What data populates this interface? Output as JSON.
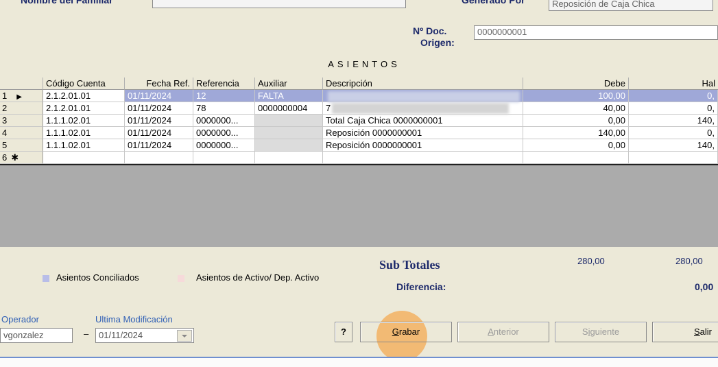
{
  "header": {
    "nombre_label": "Nombre del Familiar",
    "generado_label": "Generado Por",
    "generado_value": "Reposición de Caja Chica",
    "doc_label_1": "Nº Doc.",
    "doc_label_2": "Origen:",
    "doc_value": "0000000001"
  },
  "grid": {
    "title": "ASIENTOS",
    "columns": [
      "Código Cuenta",
      "Fecha Ref.",
      "Referencia",
      "Auxiliar",
      "Descripción",
      "Debe",
      "Hal"
    ],
    "rows": [
      {
        "num": "1",
        "marker": "▶",
        "codigo": "2.1.2.01.01",
        "fecha": "01/11/2024",
        "referencia": "12",
        "auxiliar": "FALTA",
        "descripcion": "",
        "debe": "100,00",
        "haber": "0,"
      },
      {
        "num": "2",
        "marker": "",
        "codigo": "2.1.2.01.01",
        "fecha": "01/11/2024",
        "referencia": "78",
        "auxiliar": "0000000004",
        "descripcion": "7",
        "debe": "40,00",
        "haber": "0,"
      },
      {
        "num": "3",
        "marker": "",
        "codigo": "1.1.1.02.01",
        "fecha": "01/11/2024",
        "referencia": "0000000...",
        "auxiliar": "",
        "descripcion": "Total Caja Chica 0000000001",
        "debe": "0,00",
        "haber": "140,"
      },
      {
        "num": "4",
        "marker": "",
        "codigo": "1.1.1.02.01",
        "fecha": "01/11/2024",
        "referencia": "0000000...",
        "auxiliar": "",
        "descripcion": "Reposición 0000000001",
        "debe": "140,00",
        "haber": "0,"
      },
      {
        "num": "5",
        "marker": "",
        "codigo": "1.1.1.02.01",
        "fecha": "01/11/2024",
        "referencia": "0000000...",
        "auxiliar": "",
        "descripcion": "Reposición 0000000001",
        "debe": "0,00",
        "haber": "140,"
      },
      {
        "num": "6",
        "marker": "✱",
        "codigo": "",
        "fecha": "",
        "referencia": "",
        "auxiliar": "",
        "descripcion": "",
        "debe": "",
        "haber": ""
      }
    ]
  },
  "legend": {
    "conciliados": "Asientos Conciliados",
    "activo": "Asientos de Activo/ Dep. Activo",
    "conciliados_color": "#b8bde8",
    "activo_color": "#f6dada"
  },
  "totals": {
    "sub_label": "Sub Totales",
    "debe": "280,00",
    "haber": "280,00",
    "dif_label": "Diferencia:",
    "dif_value": "0,00"
  },
  "footer": {
    "operador_label": "Operador",
    "operador_value": "vgonzalez",
    "ultima_label": "Ultima Modificación",
    "ultima_value": "01/11/2024",
    "dash": "–",
    "help_label": "?",
    "grabar_label": "Grabar",
    "anterior_label": "Anterior",
    "siguiente_label": "Siguiente",
    "salir_label": "Salir"
  },
  "colors": {
    "accent_blue": "#1d2a6b",
    "link_blue": "#2f5fb5",
    "highlight": "#f5a54a",
    "selected_row": "#9fa8d8"
  }
}
